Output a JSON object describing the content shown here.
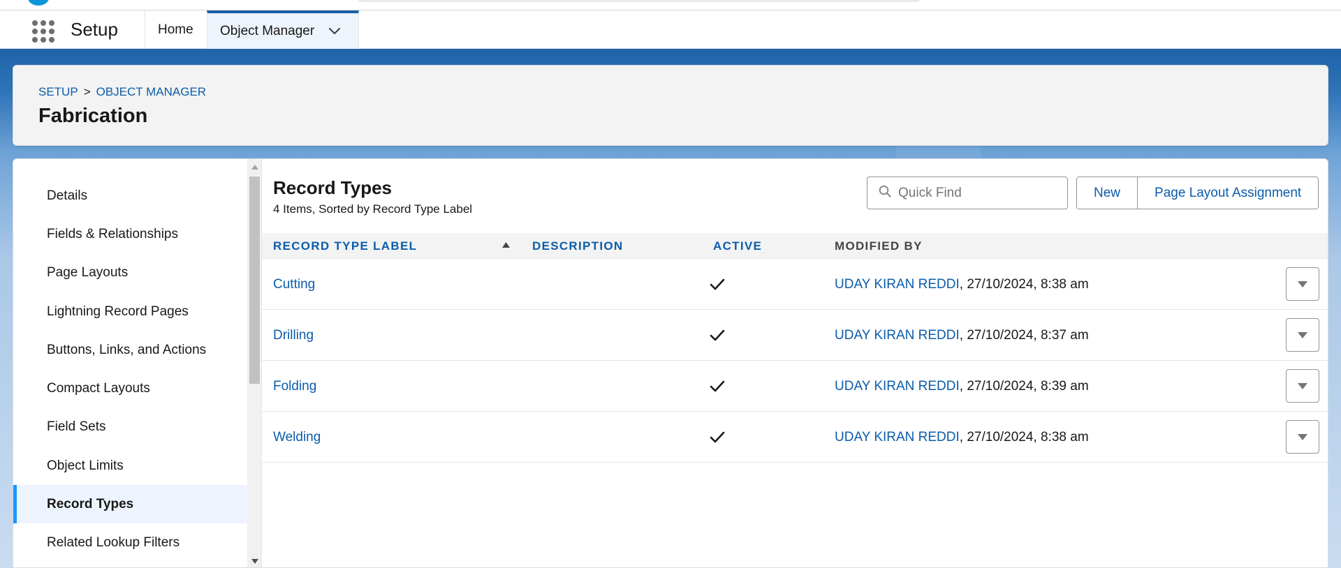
{
  "nav": {
    "app_name": "Setup",
    "home_label": "Home",
    "active_tab_label": "Object Manager"
  },
  "header": {
    "breadcrumb": [
      "SETUP",
      "OBJECT MANAGER"
    ],
    "breadcrumb_separator": ">",
    "title": "Fabrication"
  },
  "sidebar": {
    "items": [
      {
        "label": "Details"
      },
      {
        "label": "Fields & Relationships"
      },
      {
        "label": "Page Layouts"
      },
      {
        "label": "Lightning Record Pages"
      },
      {
        "label": "Buttons, Links, and Actions"
      },
      {
        "label": "Compact Layouts"
      },
      {
        "label": "Field Sets"
      },
      {
        "label": "Object Limits"
      },
      {
        "label": "Record Types"
      },
      {
        "label": "Related Lookup Filters"
      }
    ],
    "active_item": "Record Types"
  },
  "main": {
    "title": "Record Types",
    "subtitle": "4 Items, Sorted by Record Type Label",
    "search": {
      "placeholder": "Quick Find",
      "value": ""
    },
    "buttons": {
      "new_label": "New",
      "page_layout_assignment_label": "Page Layout Assignment"
    },
    "table": {
      "columns": [
        "RECORD TYPE LABEL",
        "DESCRIPTION",
        "ACTIVE",
        "MODIFIED BY"
      ],
      "rows": [
        {
          "label": "Cutting",
          "description": "",
          "active": true,
          "modified_by": "UDAY KIRAN REDDI",
          "modified_at": ", 27/10/2024, 8:38 am"
        },
        {
          "label": "Drilling",
          "description": "",
          "active": true,
          "modified_by": "UDAY KIRAN REDDI",
          "modified_at": ", 27/10/2024, 8:37 am"
        },
        {
          "label": "Folding",
          "description": "",
          "active": true,
          "modified_by": "UDAY KIRAN REDDI",
          "modified_at": ", 27/10/2024, 8:39 am"
        },
        {
          "label": "Welding",
          "description": "",
          "active": true,
          "modified_by": "UDAY KIRAN REDDI",
          "modified_at": ", 27/10/2024, 8:38 am"
        }
      ]
    }
  },
  "colors": {
    "brand_blue": "#0b5cab",
    "active_tab_border": "#1b5fa6",
    "sidebar_active_bar": "#1b96ff"
  },
  "icons": {
    "app_launcher": "waffle-grid-icon",
    "tab_menu": "chevron-down-icon",
    "search": "search-icon",
    "sort": "sort-ascending-icon",
    "active": "checkmark-icon",
    "row_action": "dropdown-icon"
  }
}
